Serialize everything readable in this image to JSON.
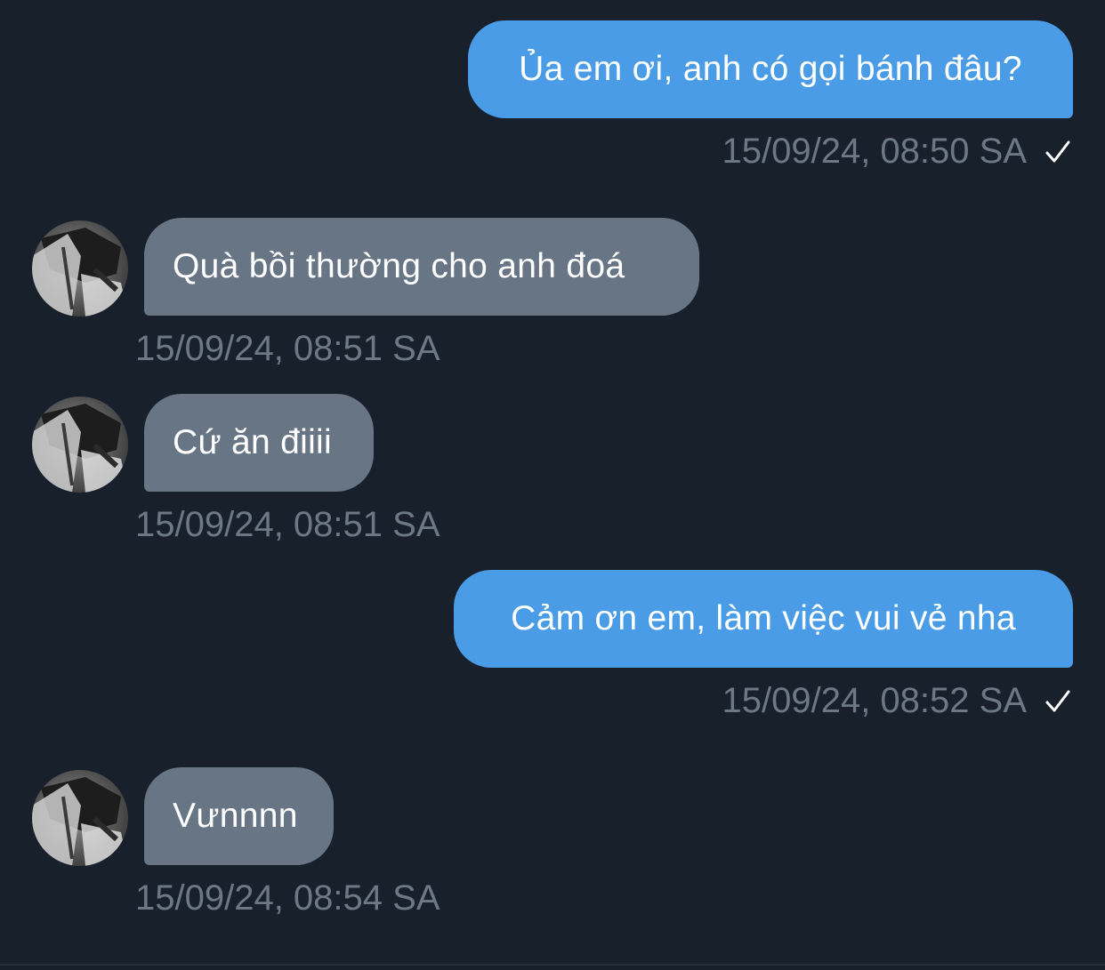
{
  "colors": {
    "background": "#18202b",
    "outgoing_bubble": "#4a9ce6",
    "incoming_bubble": "#677585",
    "timestamp": "#6c7886",
    "check": "#ffffff"
  },
  "messages": [
    {
      "direction": "outgoing",
      "text": "Ủa em ơi, anh có gọi bánh đâu?",
      "time": "15/09/24, 08:50 SA",
      "status_icon": "check-icon"
    },
    {
      "direction": "incoming",
      "text": "Quà bồi thường cho anh đoá",
      "time": "15/09/24, 08:51 SA",
      "avatar": "avatar"
    },
    {
      "direction": "incoming",
      "text": "Cứ ăn điiii",
      "time": "15/09/24, 08:51 SA",
      "avatar": "avatar"
    },
    {
      "direction": "outgoing",
      "text": "Cảm ơn em, làm việc vui vẻ nha",
      "time": "15/09/24, 08:52 SA",
      "status_icon": "check-icon"
    },
    {
      "direction": "incoming",
      "text": "Vưnnnn",
      "time": "15/09/24, 08:54 SA",
      "avatar": "avatar"
    }
  ]
}
